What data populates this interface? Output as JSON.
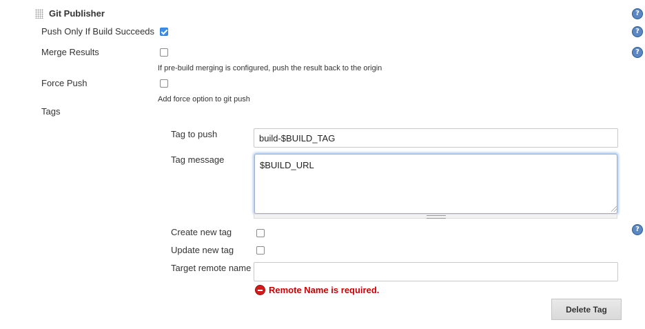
{
  "section": {
    "title": "Git Publisher"
  },
  "fields": {
    "push_only": {
      "label": "Push Only If Build Succeeds",
      "checked": true
    },
    "merge_results": {
      "label": "Merge Results",
      "checked": false,
      "hint": "If pre-build merging is configured, push the result back to the origin"
    },
    "force_push": {
      "label": "Force Push",
      "checked": false,
      "hint": "Add force option to git push"
    },
    "tags": {
      "label": "Tags"
    }
  },
  "tag": {
    "tag_to_push": {
      "label": "Tag to push",
      "value": "build-$BUILD_TAG"
    },
    "tag_message": {
      "label": "Tag message",
      "value": "$BUILD_URL"
    },
    "create_new_tag": {
      "label": "Create new tag",
      "checked": false
    },
    "update_new_tag": {
      "label": "Update new tag",
      "checked": false
    },
    "target_remote_name": {
      "label": "Target remote name",
      "value": ""
    },
    "error": "Remote Name is required.",
    "delete_button": "Delete Tag"
  },
  "help_icon_glyph": "?",
  "colors": {
    "help": "#5b87c2",
    "checkbox_checked": "#3d8ee8",
    "error": "#cc0000",
    "focus_ring": "#8ab4e8"
  }
}
